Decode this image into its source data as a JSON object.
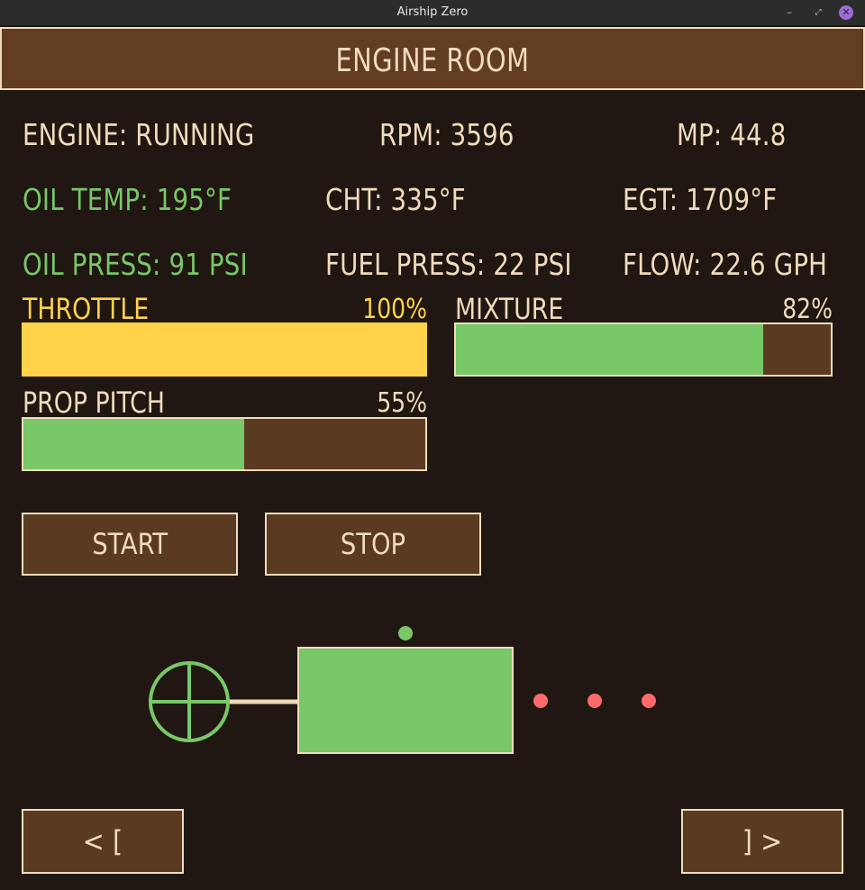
{
  "window": {
    "title": "Airship Zero",
    "minimize_glyph": "–",
    "restore_glyph": "⤢",
    "close_glyph": "✕"
  },
  "header": {
    "title": "ENGINE ROOM"
  },
  "stats": {
    "engine": "ENGINE: RUNNING",
    "rpm": "RPM: 3596",
    "mp": "MP: 44.8",
    "oil_temp": "OIL TEMP: 195°F",
    "cht": "CHT: 335°F",
    "egt": "EGT: 1709°F",
    "oil_press": "OIL PRESS: 91 PSI",
    "fuel_press": "FUEL PRESS: 22 PSI",
    "flow": "FLOW: 22.6 GPH"
  },
  "controls": {
    "throttle": {
      "label": "THROTTLE",
      "percent_text": "100%",
      "value": 1.0
    },
    "mixture": {
      "label": "MIXTURE",
      "percent_text": "82%",
      "value": 0.82
    },
    "prop_pitch": {
      "label": "PROP PITCH",
      "percent_text": "55%",
      "value": 0.55
    }
  },
  "buttons": {
    "start": "START",
    "stop": "STOP",
    "prev": "< [",
    "next": "] >"
  },
  "colors": {
    "background": "#201712",
    "panel": "#5a3a20",
    "header": "#633d1f",
    "text": "#f0dcbc",
    "ok": "#78c768",
    "highlight": "#ffd24a",
    "warning": "#ff6a6a"
  },
  "diagram": {
    "propeller_icon": "crosshair-circle-icon",
    "engine_block": "green-rectangle",
    "status_indicator": "green-dot",
    "exhaust_indicators": [
      "red-dot",
      "red-dot",
      "red-dot"
    ]
  }
}
